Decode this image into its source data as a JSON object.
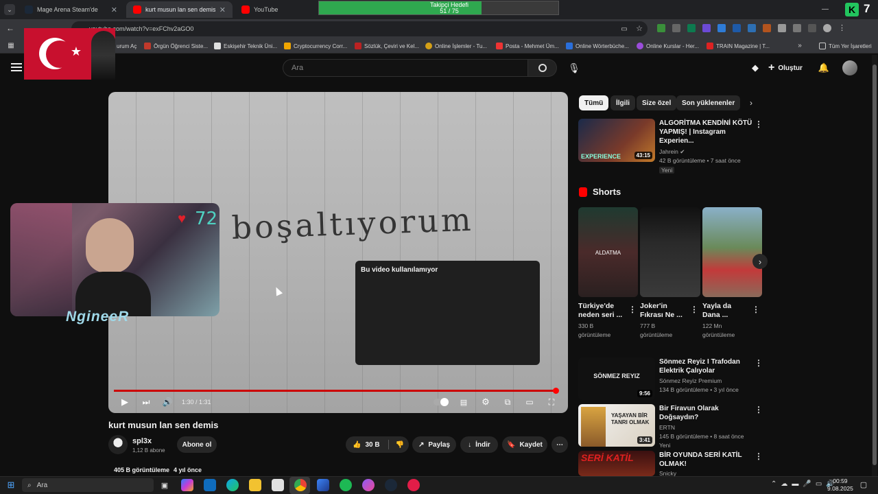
{
  "browser": {
    "tabs": [
      {
        "title": "Mage Arena Steam'de"
      },
      {
        "title": "kurt musun lan sen demis - You"
      },
      {
        "title": "YouTube"
      }
    ],
    "follower_goal": {
      "label": "Takipçi Hedefi",
      "count": "51 / 75",
      "progress": 0.68
    },
    "overlay_right": "7",
    "url": "youtube.com/watch?v=exFChv2aGO0",
    "bookmarks": [
      "urum Aç",
      "Örgün Öğrenci Siste...",
      "Eskişehir Teknik Üni...",
      "Cryptocurrency Corr...",
      "Sözlük, Çeviri ve Kel...",
      "Online İşlemler - Tu...",
      "Posta - Mehmet Üm...",
      "Online Wörterbüche...",
      "Online Kurslar - Her...",
      "TRAIN Magazine | T..."
    ],
    "all_bookmarks": "Tüm Yer İşaretleri"
  },
  "yt": {
    "search_placeholder": "Ara",
    "create_label": "Oluştur"
  },
  "player": {
    "unavailable": "Bu video kullanılamıyor",
    "time": "1:30 / 1:31",
    "progress": 0.99,
    "handwriting": "lerimi boşaltıyorum",
    "webcam_heart": "72",
    "webcam_name": "NgineeR"
  },
  "video": {
    "title": "kurt musun lan sen demis",
    "channel": "spl3x",
    "subs": "1,12 B abone",
    "subscribe": "Abone ol",
    "likes": "30 B",
    "share": "Paylaş",
    "download": "İndir",
    "save": "Kaydet",
    "views": "405 B görüntüleme",
    "age": "4 yıl önce"
  },
  "chips": [
    "Tümü",
    "İlgili",
    "Size özel",
    "Son yüklenenler"
  ],
  "recs": [
    {
      "title1": "ALGORİTMA KENDİNİ KÖTÜ",
      "title2": "YAPMIŞ! | Instagram Experien...",
      "channel": "Jahrein",
      "meta": "42 B görüntüleme • 7 saat önce",
      "badge": "Yeni",
      "duration": "43:15",
      "thumb_text": "EXPERIENCE"
    },
    {
      "title1": "Sönmez Reyiz I Trafodan",
      "title2": "Elektrik Çalıyolar",
      "channel": "Sönmez Reyiz Premium",
      "meta": "134 B görüntüleme • 3 yıl önce",
      "badge": "",
      "duration": "9:56",
      "thumb_text": "SÖNMEZ REYIZ"
    },
    {
      "title1": "Bir Firavun Olarak Doğsaydın?",
      "title2": "",
      "channel": "ERTN",
      "meta": "145 B görüntüleme • 8 saat önce",
      "badge": "Yeni",
      "duration": "3:41",
      "thumb_text": "YAŞAYAN BİR TANRI OLMAK"
    },
    {
      "title1": "BİR OYUNDA SERİ KATİL",
      "title2": "OLMAK!",
      "channel": "Snicky",
      "meta": "",
      "badge": "",
      "duration": "",
      "thumb_text": "SERİ KATİL"
    }
  ],
  "shorts": {
    "heading": "Shorts",
    "items": [
      {
        "t1": "Türkiye'de",
        "t2": "neden seri ...",
        "v1": "330 B",
        "v2": "görüntüleme",
        "thumb_text": "ALDATMA"
      },
      {
        "t1": "Joker'in",
        "t2": "Fıkrası Ne ...",
        "v1": "777 B",
        "v2": "görüntüleme",
        "thumb_text": ""
      },
      {
        "t1": "Yayla da",
        "t2": "Dana ...",
        "v1": "122 Mn",
        "v2": "görüntüleme",
        "thumb_text": ""
      }
    ]
  },
  "taskbar": {
    "search": "Ara",
    "time": "00:59",
    "date": "9.08.2025"
  },
  "colors": {
    "accent": "#ff0000",
    "goal_bar": "#2fa84f"
  }
}
